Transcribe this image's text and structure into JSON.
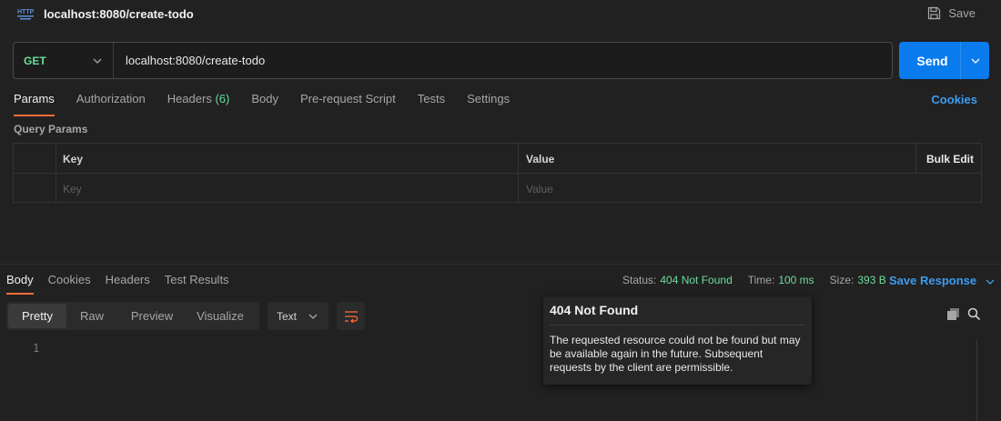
{
  "header": {
    "icon": "http-icon",
    "title": "localhost:8080/create-todo",
    "save_label": "Save"
  },
  "request": {
    "method": "GET",
    "url": "localhost:8080/create-todo",
    "send_label": "Send"
  },
  "req_tabs": [
    {
      "label": "Params",
      "active": true
    },
    {
      "label": "Authorization"
    },
    {
      "label": "Headers",
      "count": "(6)"
    },
    {
      "label": "Body"
    },
    {
      "label": "Pre-request Script"
    },
    {
      "label": "Tests"
    },
    {
      "label": "Settings"
    }
  ],
  "cookies_label": "Cookies",
  "query_params": {
    "title": "Query Params",
    "col_key": "Key",
    "col_value": "Value",
    "bulk_edit": "Bulk Edit",
    "key_placeholder": "Key",
    "value_placeholder": "Value"
  },
  "resp_tabs": [
    {
      "label": "Body",
      "active": true
    },
    {
      "label": "Cookies"
    },
    {
      "label": "Headers"
    },
    {
      "label": "Test Results"
    }
  ],
  "status": {
    "status_label": "Status:",
    "status_value": "404 Not Found",
    "time_label": "Time:",
    "time_value": "100 ms",
    "size_label": "Size:",
    "size_value": "393 B",
    "save_response": "Save Response"
  },
  "view_modes": [
    "Pretty",
    "Raw",
    "Preview",
    "Visualize"
  ],
  "format": "Text",
  "line_number": "1",
  "tooltip": {
    "title": "404 Not Found",
    "body": "The requested resource could not be found but may be available again in the future. Subsequent requests by the client are permissible."
  },
  "colors": {
    "accent_orange": "#ff6c37",
    "send_blue": "#097bed",
    "status_green": "#6bdd9a",
    "link_blue": "#3d9bf0"
  }
}
